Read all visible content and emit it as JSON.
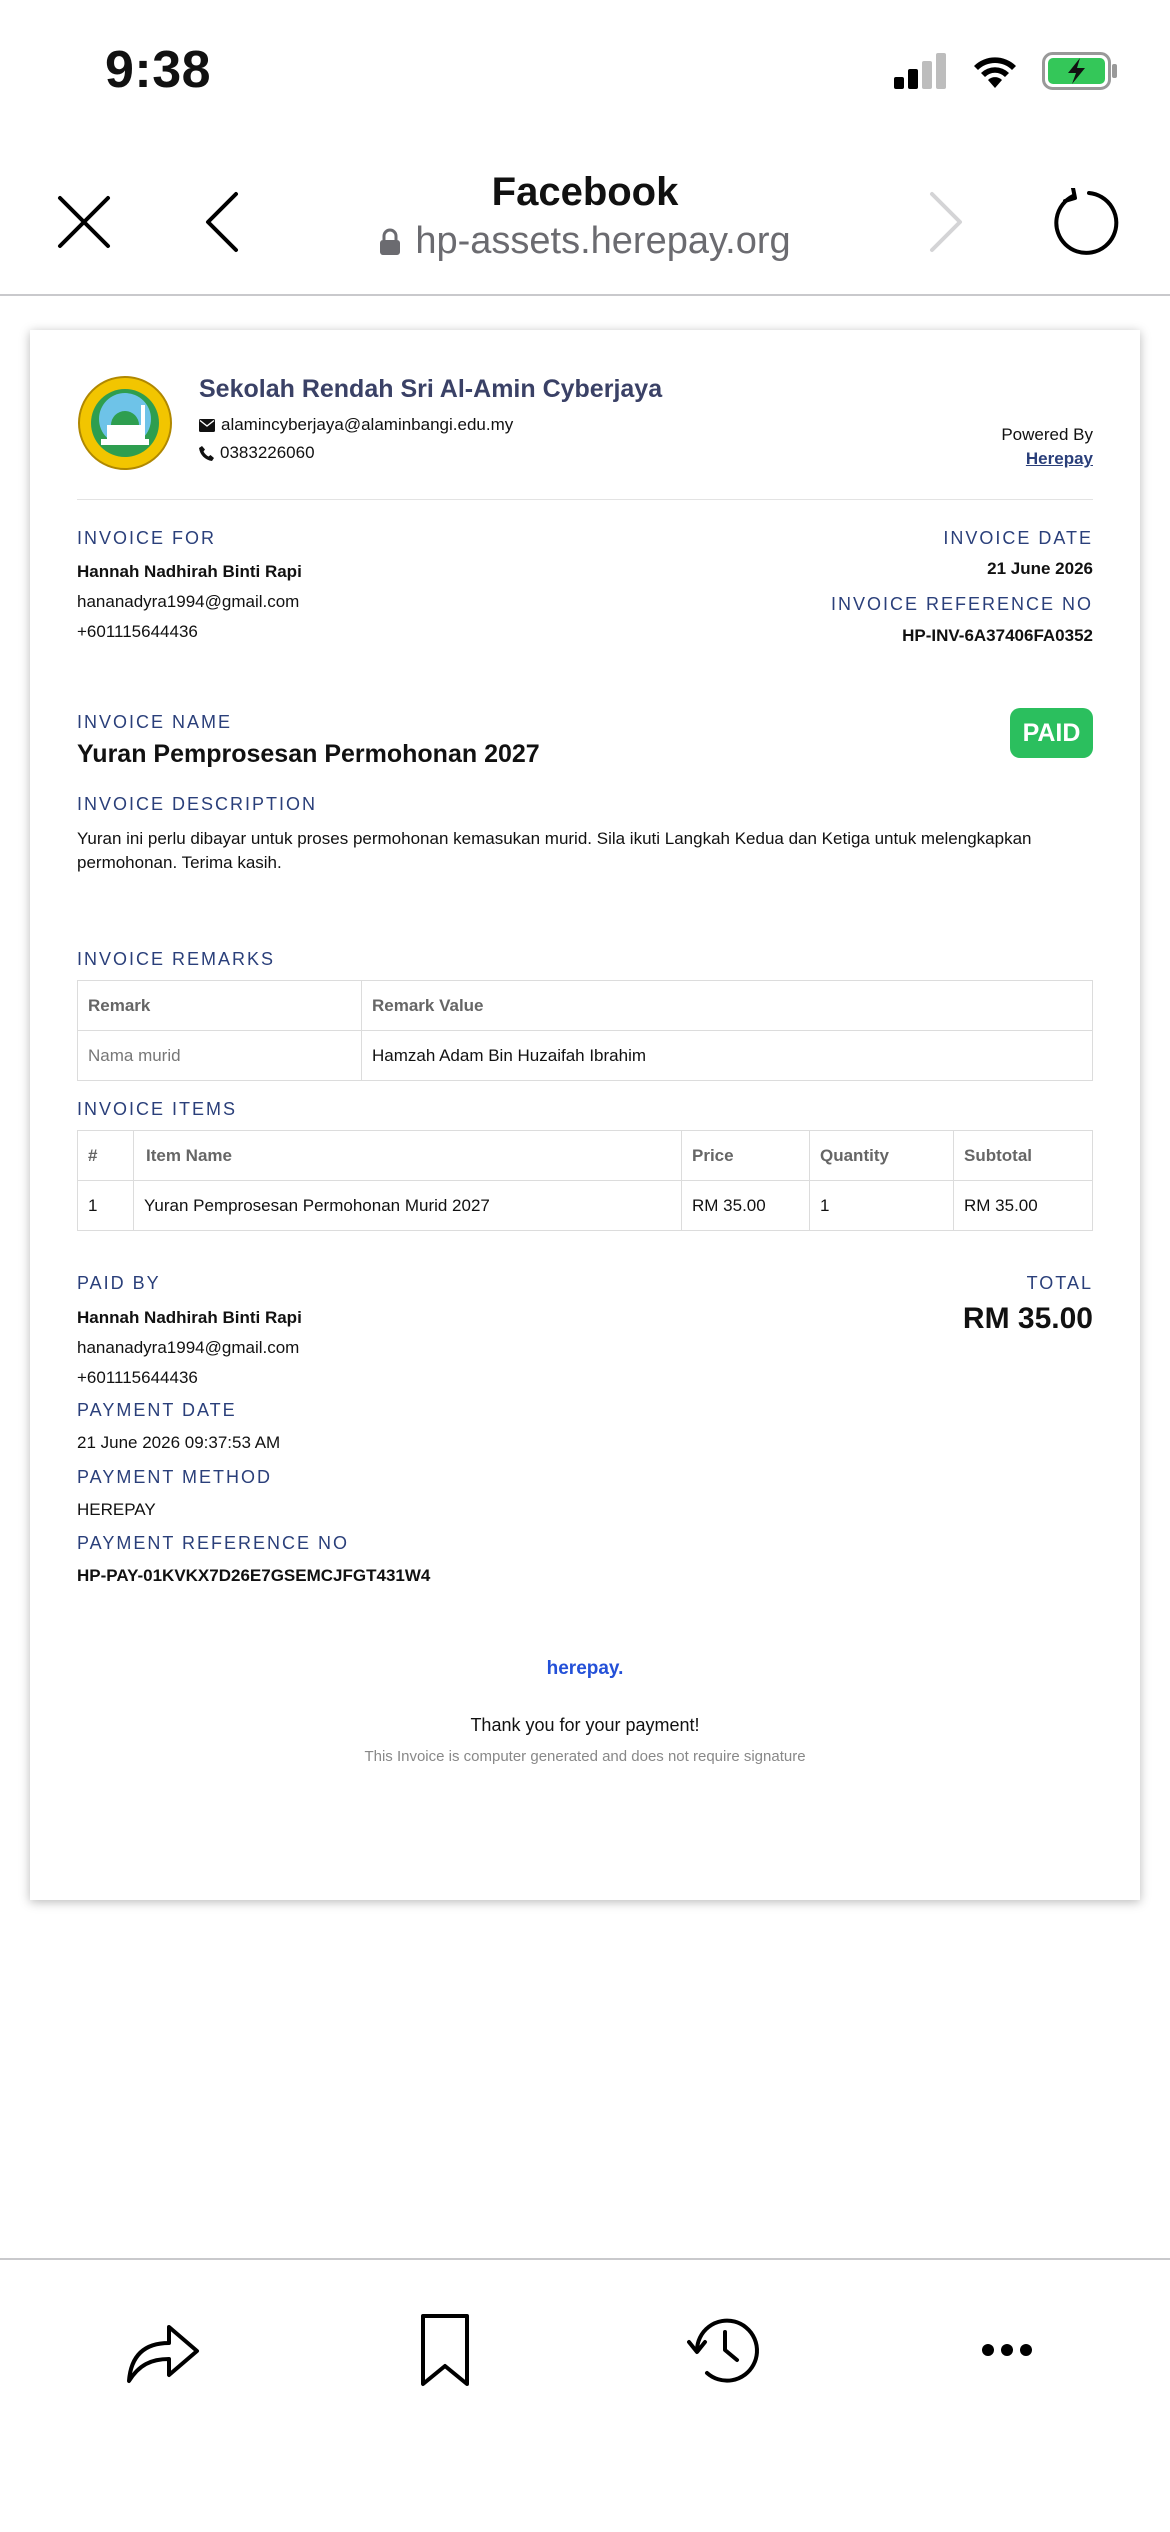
{
  "status_bar": {
    "time": "9:38"
  },
  "browser": {
    "title": "Facebook",
    "url": "hp-assets.herepay.org"
  },
  "school": {
    "name": "Sekolah Rendah Sri Al-Amin Cyberjaya",
    "email": "alamincyberjaya@alaminbangi.edu.my",
    "phone": "0383226060",
    "powered_label": "Powered By",
    "powered_link": "Herepay"
  },
  "invoice": {
    "for_label": "INVOICE FOR",
    "for_name": "Hannah Nadhirah Binti Rapi",
    "for_email": "hananadyra1994@gmail.com",
    "for_phone": "+601115644436",
    "date_label": "INVOICE DATE",
    "date": "21 June 2026",
    "ref_label": "INVOICE REFERENCE NO",
    "ref": "HP-INV-6A37406FA0352",
    "name_label": "INVOICE NAME",
    "name": "Yuran Pemprosesan Permohonan 2027",
    "status": "PAID",
    "desc_label": "INVOICE DESCRIPTION",
    "desc": "Yuran ini perlu dibayar untuk proses permohonan kemasukan murid. Sila ikuti Langkah Kedua dan Ketiga untuk melengkapkan permohonan. Terima kasih."
  },
  "remarks": {
    "label": "INVOICE REMARKS",
    "headers": [
      "Remark",
      "Remark Value"
    ],
    "rows": [
      [
        "Nama murid",
        "Hamzah Adam Bin Huzaifah Ibrahim"
      ]
    ]
  },
  "items": {
    "label": "INVOICE ITEMS",
    "headers": [
      "#",
      "Item Name",
      "Price",
      "Quantity",
      "Subtotal"
    ],
    "rows": [
      [
        "1",
        "Yuran Pemprosesan Permohonan Murid 2027",
        "RM 35.00",
        "1",
        "RM 35.00"
      ]
    ]
  },
  "payment": {
    "paid_by_label": "PAID BY",
    "paid_by_name": "Hannah Nadhirah Binti Rapi",
    "paid_by_email": "hananadyra1994@gmail.com",
    "paid_by_phone": "+601115644436",
    "total_label": "TOTAL",
    "total": "RM 35.00",
    "date_label": "PAYMENT DATE",
    "date": "21 June 2026 09:37:53 AM",
    "method_label": "PAYMENT METHOD",
    "method": "HEREPAY",
    "ref_label": "PAYMENT REFERENCE NO",
    "ref": "HP-PAY-01KVKX7D26E7GSEMCJFGT431W4"
  },
  "footer": {
    "brand": "herepay.",
    "thanks": "Thank you for your payment!",
    "note": "This Invoice is computer generated and does not require signature"
  },
  "colors": {
    "accent": "#2a3f7a",
    "paid": "#2bbf5e",
    "battery": "#34c759"
  }
}
